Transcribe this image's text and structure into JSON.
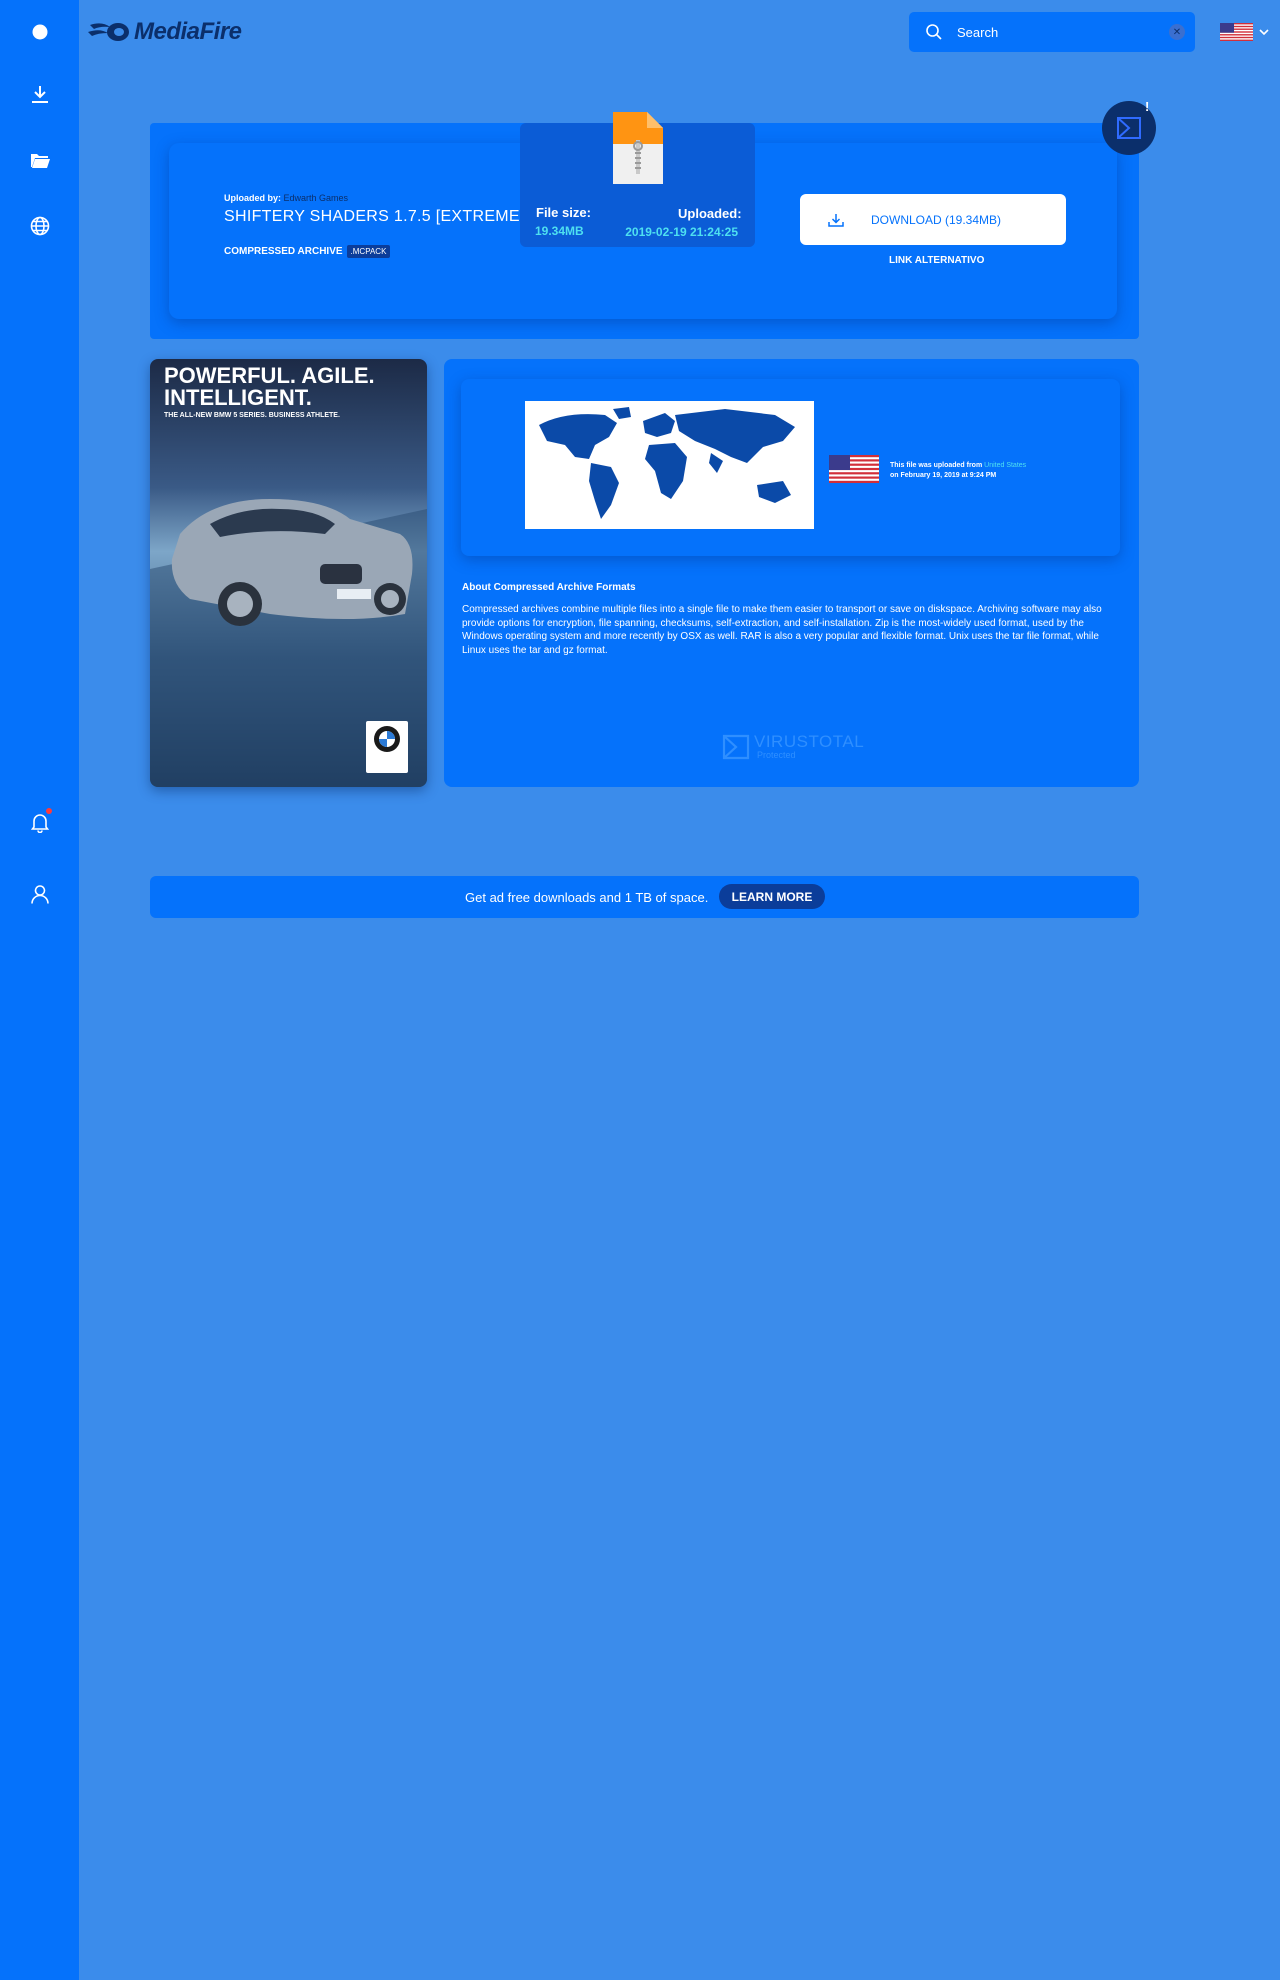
{
  "brand": {
    "name": "MediaFire"
  },
  "search": {
    "placeholder": "Search"
  },
  "file": {
    "uploaded_by_label": "Uploaded by:",
    "uploader": "Edwarth Games",
    "title": "SHIFTERY SHADERS 1.7.5 [EXTREME]",
    "type_label": "COMPRESSED ARCHIVE",
    "extension": ".MCPACK",
    "size_label": "File size:",
    "size_value": "19.34MB",
    "uploaded_label": "Uploaded:",
    "uploaded_value": "2019-02-19 21:24:25"
  },
  "actions": {
    "download_label": "DOWNLOAD (19.34MB)",
    "alt_link_label": "LINK ALTERNATIVO"
  },
  "virustotal": {
    "alert": "!",
    "name": "VIRUSTOTAL",
    "status": "Protected"
  },
  "ad": {
    "headline_1": "POWERFUL. AGILE.",
    "headline_2": "INTELLIGENT.",
    "subline": "THE ALL-NEW BMW 5 SERIES. BUSINESS ATHLETE."
  },
  "location": {
    "prefix": "This file was uploaded from",
    "country": "United States",
    "date_line": "on February 19, 2019 at 9:24 PM"
  },
  "about": {
    "title": "About Compressed Archive Formats",
    "text": "Compressed archives combine multiple files into a single file to make them easier to transport or save on diskspace. Archiving software may also provide options for encryption, file spanning, checksums, self-extraction, and self-installation. Zip is the most-widely used format, used by the Windows operating system and more recently by OSX as well. RAR is also a very popular and flexible format. Unix uses the tar file format, while Linux uses the tar and gz format."
  },
  "promo": {
    "text": "Get ad free downloads and 1 TB of space.",
    "button_label": "LEARN MORE"
  },
  "colors": {
    "page_bg": "#3b8ceb",
    "sidebar_bg": "#0572fb",
    "panel_bg": "#0572fb",
    "accent_text": "#4ee0f0",
    "dark_navy": "#0b2f6b",
    "map_land": "#0b4aa8"
  },
  "icons": {
    "sidebar": [
      "circle-icon",
      "download-icon",
      "folder-icon",
      "globe-icon",
      "bell-icon",
      "user-icon"
    ],
    "header": [
      "logo-icon",
      "search-icon",
      "clear-icon",
      "us-flag-icon",
      "chevron-down-icon"
    ]
  }
}
